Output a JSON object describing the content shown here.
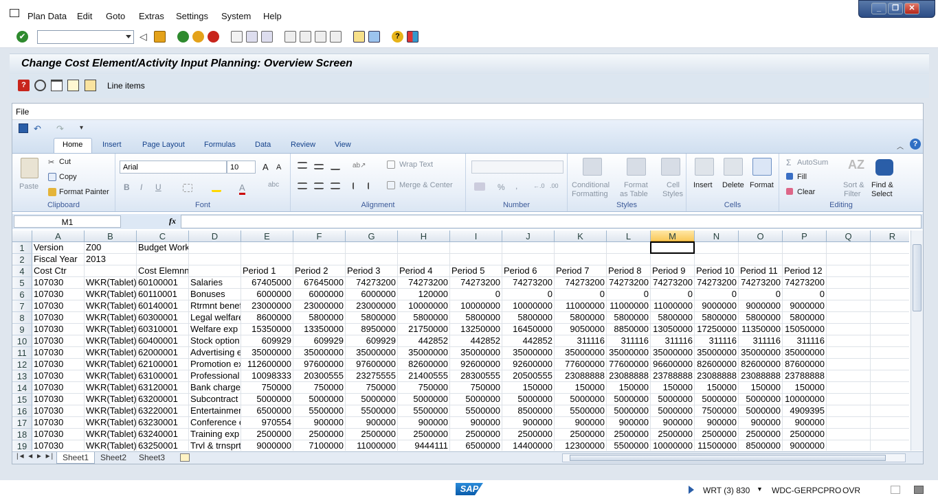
{
  "menu": [
    "Plan Data",
    "Edit",
    "Goto",
    "Extras",
    "Settings",
    "System",
    "Help"
  ],
  "screen_title": "Change Cost Element/Activity Input Planning: Overview Screen",
  "app_toolbar": {
    "line_items_label": "Line items"
  },
  "excel": {
    "file_label": "File",
    "tabs": [
      "Home",
      "Insert",
      "Page Layout",
      "Formulas",
      "Data",
      "Review",
      "View"
    ],
    "clipboard": {
      "paste": "Paste",
      "cut": "Cut",
      "copy": "Copy",
      "format_painter": "Format Painter",
      "group": "Clipboard"
    },
    "font": {
      "name": "Arial",
      "size": "10",
      "group": "Font"
    },
    "alignment": {
      "wrap": "Wrap Text",
      "merge": "Merge & Center",
      "group": "Alignment"
    },
    "number": {
      "group": "Number"
    },
    "styles": {
      "cond1": "Conditional",
      "cond2": "Formatting",
      "fmt1": "Format",
      "fmt2": "as Table",
      "cell1": "Cell",
      "cell2": "Styles",
      "group": "Styles"
    },
    "cells": {
      "insert": "Insert",
      "delete": "Delete",
      "format": "Format",
      "group": "Cells"
    },
    "editing": {
      "autosum": "AutoSum",
      "fill": "Fill",
      "clear": "Clear",
      "sort1": "Sort &",
      "sort2": "Filter",
      "find1": "Find &",
      "find2": "Select",
      "group": "Editing"
    },
    "name_box": "M1",
    "fx": "fx",
    "columns": [
      "A",
      "B",
      "C",
      "D",
      "E",
      "F",
      "G",
      "H",
      "I",
      "J",
      "K",
      "L",
      "M",
      "N",
      "O",
      "P",
      "Q",
      "R"
    ],
    "selected_column": "M",
    "rows": [
      {
        "num": "1",
        "cells": [
          "Version",
          "Z00",
          "Budget Work Area",
          "",
          "",
          "",
          "",
          "",
          "",
          "",
          "",
          "",
          "",
          "",
          "",
          "",
          "",
          ""
        ]
      },
      {
        "num": "2",
        "cells": [
          "Fiscal Year",
          "2013",
          "",
          "",
          "",
          "",
          "",
          "",
          "",
          "",
          "",
          "",
          "",
          "",
          "",
          "",
          "",
          ""
        ]
      },
      {
        "num": "4",
        "cells": [
          "Cost Ctr",
          "",
          "Cost Elemnnt",
          "",
          "Period 1",
          "Period 2",
          "Period 3",
          "Period 4",
          "Period 5",
          "Period 6",
          "Period 7",
          "Period 8",
          "Period 9",
          "Period 10",
          "Period 11",
          "Period 12",
          "",
          ""
        ]
      },
      {
        "num": "5",
        "cells": [
          "107030",
          "WKR(Tablet)",
          "60100001",
          "Salaries",
          "67405000",
          "67645000",
          "74273200",
          "74273200",
          "74273200",
          "74273200",
          "74273200",
          "74273200",
          "74273200",
          "74273200",
          "74273200",
          "74273200",
          "",
          ""
        ]
      },
      {
        "num": "6",
        "cells": [
          "107030",
          "WKR(Tablet)",
          "60110001",
          "Bonuses",
          "6000000",
          "6000000",
          "6000000",
          "120000",
          "0",
          "0",
          "0",
          "0",
          "0",
          "0",
          "0",
          "0",
          "",
          ""
        ]
      },
      {
        "num": "7",
        "cells": [
          "107030",
          "WKR(Tablet)",
          "60140001",
          "Rtrmnt benef",
          "23000000",
          "23000000",
          "23000000",
          "10000000",
          "10000000",
          "10000000",
          "11000000",
          "11000000",
          "11000000",
          "9000000",
          "9000000",
          "9000000",
          "",
          ""
        ]
      },
      {
        "num": "8",
        "cells": [
          "107030",
          "WKR(Tablet)",
          "60300001",
          "Legal welfare",
          "8600000",
          "5800000",
          "5800000",
          "5800000",
          "5800000",
          "5800000",
          "5800000",
          "5800000",
          "5800000",
          "5800000",
          "5800000",
          "5800000",
          "",
          ""
        ]
      },
      {
        "num": "9",
        "cells": [
          "107030",
          "WKR(Tablet)",
          "60310001",
          "Welfare exp",
          "15350000",
          "13350000",
          "8950000",
          "21750000",
          "13250000",
          "16450000",
          "9050000",
          "8850000",
          "13050000",
          "17250000",
          "11350000",
          "15050000",
          "",
          ""
        ]
      },
      {
        "num": "10",
        "cells": [
          "107030",
          "WKR(Tablet)",
          "60400001",
          "Stock option",
          "609929",
          "609929",
          "609929",
          "442852",
          "442852",
          "442852",
          "311116",
          "311116",
          "311116",
          "311116",
          "311116",
          "311116",
          "",
          ""
        ]
      },
      {
        "num": "11",
        "cells": [
          "107030",
          "WKR(Tablet)",
          "62000001",
          "Advertising e",
          "35000000",
          "35000000",
          "35000000",
          "35000000",
          "35000000",
          "35000000",
          "35000000",
          "35000000",
          "35000000",
          "35000000",
          "35000000",
          "35000000",
          "",
          ""
        ]
      },
      {
        "num": "12",
        "cells": [
          "107030",
          "WKR(Tablet)",
          "62100001",
          "Promotion ex",
          "112600000",
          "97600000",
          "97600000",
          "82600000",
          "92600000",
          "92600000",
          "77600000",
          "77600000",
          "96600000",
          "82600000",
          "82600000",
          "87600000",
          "",
          ""
        ]
      },
      {
        "num": "13",
        "cells": [
          "107030",
          "WKR(Tablet)",
          "63100001",
          "Professional",
          "10098333",
          "20300555",
          "23275555",
          "21400555",
          "28300555",
          "20500555",
          "23088888",
          "23088888",
          "23788888",
          "23088888",
          "23088888",
          "23788888",
          "",
          ""
        ]
      },
      {
        "num": "14",
        "cells": [
          "107030",
          "WKR(Tablet)",
          "63120001",
          "Bank charge",
          "750000",
          "750000",
          "750000",
          "750000",
          "750000",
          "150000",
          "150000",
          "150000",
          "150000",
          "150000",
          "150000",
          "150000",
          "",
          ""
        ]
      },
      {
        "num": "15",
        "cells": [
          "107030",
          "WKR(Tablet)",
          "63200001",
          "Subcontract",
          "5000000",
          "5000000",
          "5000000",
          "5000000",
          "5000000",
          "5000000",
          "5000000",
          "5000000",
          "5000000",
          "5000000",
          "5000000",
          "10000000",
          "",
          ""
        ]
      },
      {
        "num": "16",
        "cells": [
          "107030",
          "WKR(Tablet)",
          "63220001",
          "Entertainmer",
          "6500000",
          "5500000",
          "5500000",
          "5500000",
          "5500000",
          "8500000",
          "5500000",
          "5000000",
          "5000000",
          "7500000",
          "5000000",
          "4909395",
          "",
          ""
        ]
      },
      {
        "num": "17",
        "cells": [
          "107030",
          "WKR(Tablet)",
          "63230001",
          "Conference e",
          "970554",
          "900000",
          "900000",
          "900000",
          "900000",
          "900000",
          "900000",
          "900000",
          "900000",
          "900000",
          "900000",
          "900000",
          "",
          ""
        ]
      },
      {
        "num": "18",
        "cells": [
          "107030",
          "WKR(Tablet)",
          "63240001",
          "Training exp",
          "2500000",
          "2500000",
          "2500000",
          "2500000",
          "2500000",
          "2500000",
          "2500000",
          "2500000",
          "2500000",
          "2500000",
          "2500000",
          "2500000",
          "",
          ""
        ]
      },
      {
        "num": "19",
        "cells": [
          "107030",
          "WKR(Tablet)",
          "63250001",
          "Trvl & trnsprt",
          "9000000",
          "7100000",
          "11000000",
          "9444111",
          "6500000",
          "14400000",
          "12300000",
          "5500000",
          "10000000",
          "11500000",
          "8500000",
          "9000000",
          "",
          ""
        ]
      }
    ],
    "sheets": [
      "Sheet1",
      "Sheet2",
      "Sheet3"
    ]
  },
  "status": {
    "system": "WRT (3) 830",
    "server": "WDC-GERPCPRO",
    "mode": "OVR",
    "logo": "SAP"
  }
}
